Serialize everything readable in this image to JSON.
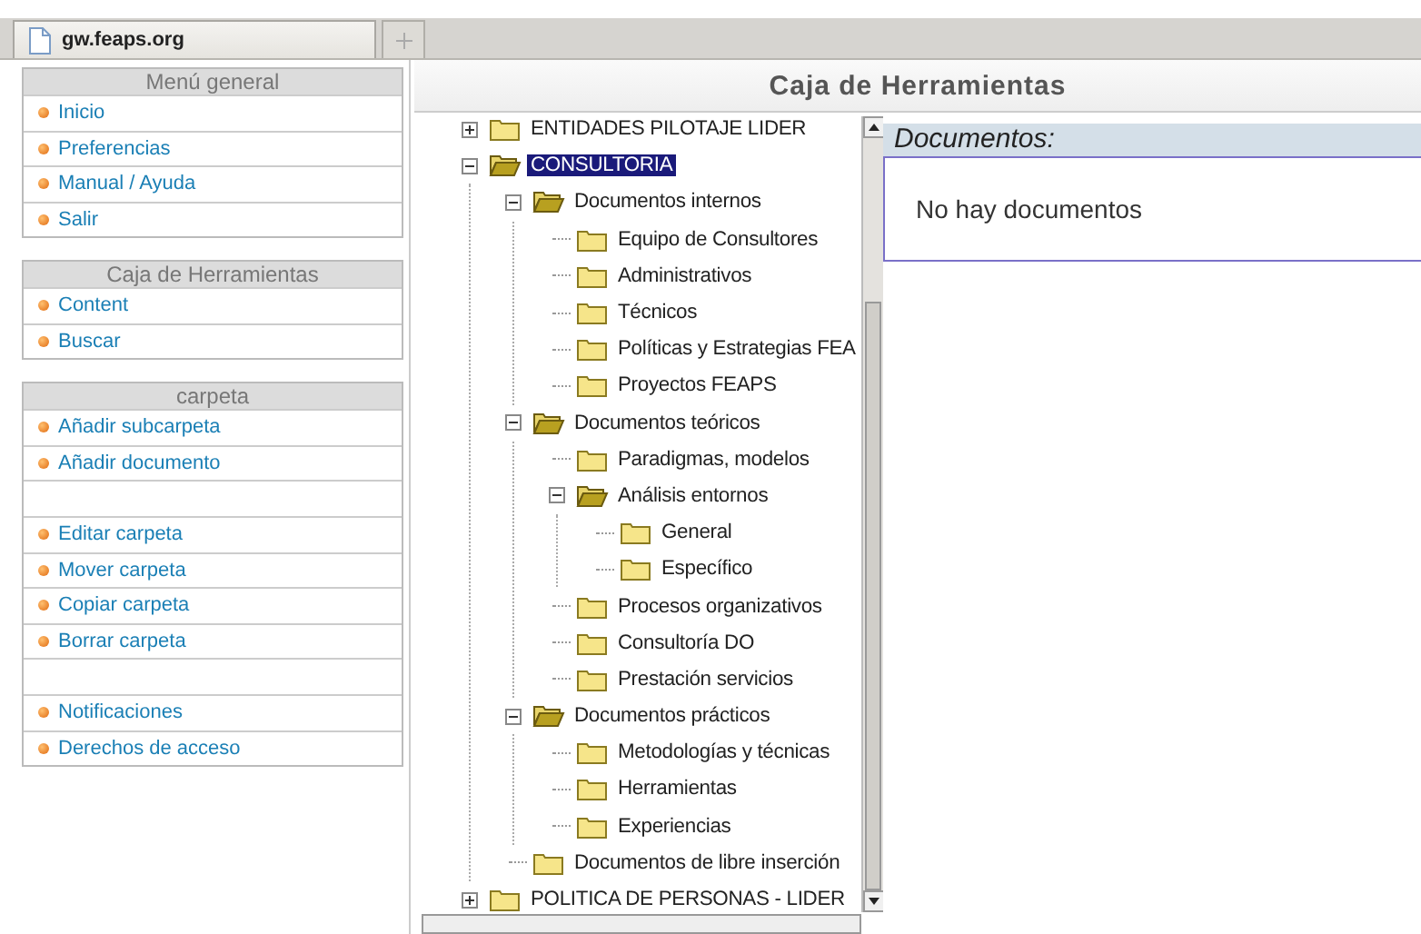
{
  "tabs": [
    {
      "label": "gw.feaps.org",
      "selected": true
    }
  ],
  "menus": [
    {
      "title": "Menú general",
      "items": [
        {
          "kind": "link",
          "label": "Inicio"
        },
        {
          "kind": "link",
          "label": "Preferencias"
        },
        {
          "kind": "link",
          "label": "Manual / Ayuda"
        },
        {
          "kind": "link",
          "label": "Salir"
        }
      ]
    },
    {
      "title": "Caja de Herramientas",
      "items": [
        {
          "kind": "link",
          "label": "Content"
        },
        {
          "kind": "link",
          "label": "Buscar"
        }
      ]
    },
    {
      "title": "carpeta",
      "items": [
        {
          "kind": "link",
          "label": "Añadir subcarpeta"
        },
        {
          "kind": "link",
          "label": "Añadir documento"
        },
        {
          "kind": "spacer"
        },
        {
          "kind": "link",
          "label": "Editar carpeta"
        },
        {
          "kind": "link",
          "label": "Mover carpeta"
        },
        {
          "kind": "link",
          "label": "Copiar carpeta"
        },
        {
          "kind": "link",
          "label": "Borrar carpeta"
        },
        {
          "kind": "spacer"
        },
        {
          "kind": "link",
          "label": "Notificaciones"
        },
        {
          "kind": "link",
          "label": "Derechos de acceso"
        }
      ]
    }
  ],
  "page_title": "Caja de Herramientas",
  "tree": [
    {
      "label": "ENTIDADES PILOTAJE LIDER",
      "selected": false,
      "expanded": false
    },
    {
      "label": "CONSULTORIA",
      "selected": true,
      "expanded": true,
      "children": [
        {
          "label": "Documentos internos",
          "selected": false,
          "expanded": true,
          "children": [
            {
              "label": "Equipo de Consultores",
              "selected": false
            },
            {
              "label": "Administrativos",
              "selected": false
            },
            {
              "label": "Técnicos",
              "selected": false
            },
            {
              "label": "Políticas y Estrategias FEA",
              "selected": false
            },
            {
              "label": "Proyectos FEAPS",
              "selected": false
            }
          ]
        },
        {
          "label": "Documentos teóricos",
          "selected": false,
          "expanded": true,
          "children": [
            {
              "label": "Paradigmas, modelos",
              "selected": false
            },
            {
              "label": "Análisis entornos",
              "selected": false,
              "expanded": true,
              "children": [
                {
                  "label": "General",
                  "selected": false
                },
                {
                  "label": "Específico",
                  "selected": false
                }
              ]
            },
            {
              "label": "Procesos organizativos",
              "selected": false
            },
            {
              "label": "Consultoría DO",
              "selected": false
            },
            {
              "label": "Prestación servicios",
              "selected": false
            }
          ]
        },
        {
          "label": "Documentos prácticos",
          "selected": false,
          "expanded": true,
          "children": [
            {
              "label": "Metodologías y técnicas",
              "selected": false
            },
            {
              "label": "Herramientas",
              "selected": false
            },
            {
              "label": "Experiencias",
              "selected": false
            }
          ]
        },
        {
          "label": "Documentos de libre inserción",
          "selected": false
        }
      ]
    },
    {
      "label": "POLITICA DE PERSONAS - LIDER",
      "selected": false,
      "expanded": false
    }
  ],
  "documents": {
    "title": "Documentos:",
    "message": "No hay documentos"
  }
}
